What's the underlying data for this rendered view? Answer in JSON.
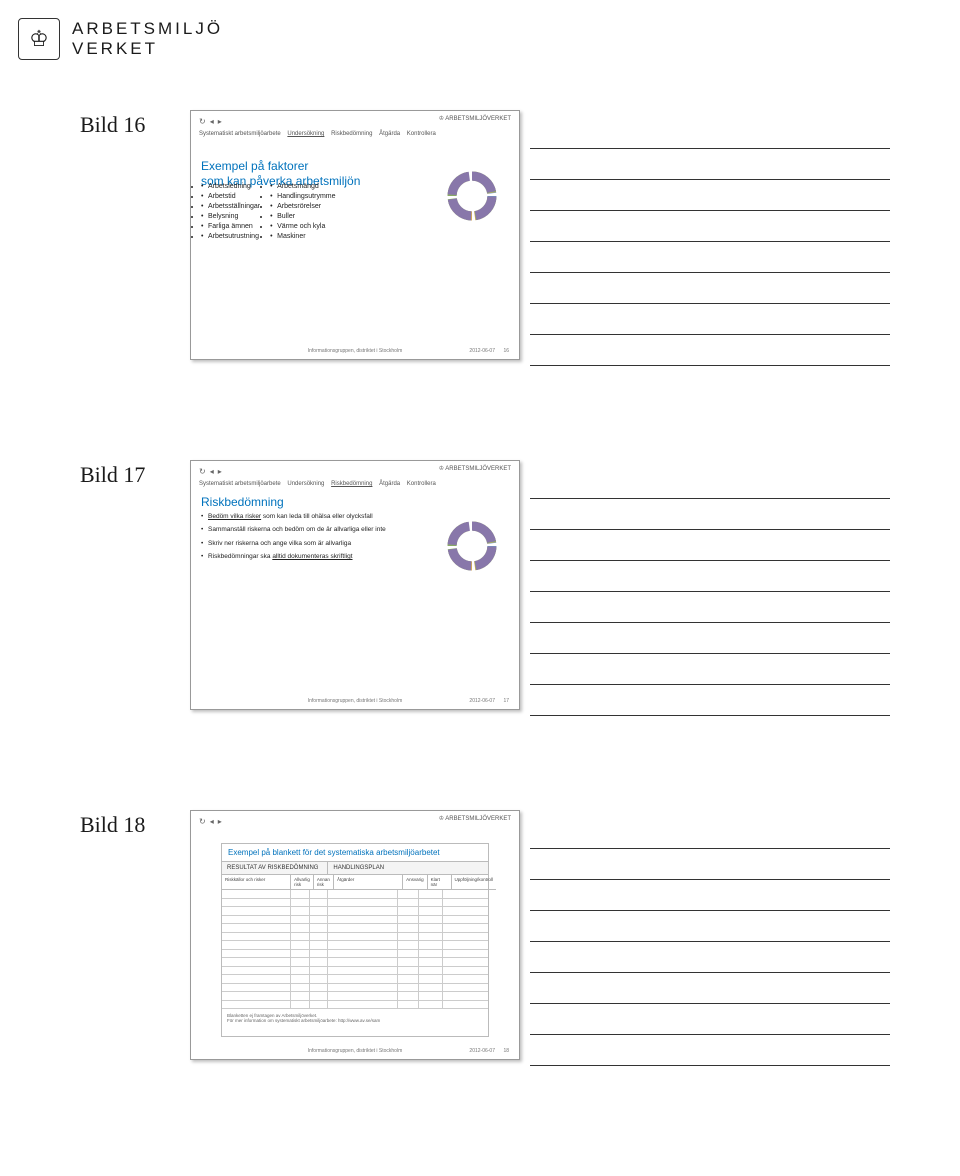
{
  "logo": {
    "line1": "ARBETSMILJÖ",
    "line2": "VERKET",
    "crest_glyph": "♔"
  },
  "slides": [
    {
      "label": "Bild 16",
      "crumbs": [
        "Systematiskt arbetsmiljöarbete",
        "Undersökning",
        "Riskbedömning",
        "Åtgärda",
        "Kontrollera"
      ],
      "crumb_underline_index": 1,
      "title": "Exempel på faktorer\nsom kan påverka arbetsmiljön",
      "left_col": [
        "Arbetsledning",
        "Arbetstid",
        "Arbetsställningar",
        "Belysning",
        "Farliga ämnen",
        "Arbetsutrustning"
      ],
      "right_col": [
        "Arbetsmängd",
        "Handlingsutrymme",
        "Arbetsrörelser",
        "Buller",
        "Värme och kyla",
        "Maskiner"
      ],
      "footer_center": "Informationsgruppen, distriktet i Stockholm",
      "footer_date": "2012-06-07",
      "footer_page": "16"
    },
    {
      "label": "Bild 17",
      "crumbs": [
        "Systematiskt arbetsmiljöarbete",
        "Undersökning",
        "Riskbedömning",
        "Åtgärda",
        "Kontrollera"
      ],
      "crumb_underline_index": 2,
      "title": "Riskbedömning",
      "bullets": [
        {
          "lead_underline": "Bedöm vilka risker",
          "rest": " som kan leda till ohälsa eller olycksfall"
        },
        {
          "lead_underline": "",
          "rest": "Sammanställ riskerna och bedöm om de är allvarliga eller inte"
        },
        {
          "lead_underline": "",
          "rest": "Skriv ner riskerna och ange vilka som är allvarliga"
        },
        {
          "lead_underline": "",
          "rest_before": "Riskbedömningar ska ",
          "mid_underline": "alltid dokumenteras skriftligt",
          "rest": ""
        }
      ],
      "footer_center": "Informationsgruppen, distriktet i Stockholm",
      "footer_date": "2012-06-07",
      "footer_page": "17"
    },
    {
      "label": "Bild 18",
      "blankett_title": "Exempel på blankett för det systematiska arbetsmiljöarbetet",
      "section1": "RESULTAT AV RISKBEDÖMNING",
      "section2": "HANDLINGSPLAN",
      "cols": [
        "Riskkällor och risker",
        "Allvarlig risk",
        "Annan risk",
        "Åtgärder",
        "Ansvarig",
        "Klart när",
        "Uppföljning/kontroll"
      ],
      "note1": "Blanketten ej framtagen av Arbetsmiljöverket.",
      "note2": "För mer information om systematiskt arbetsmiljöarbete: http://www.av.se/sam",
      "footer_center": "Informationsgruppen, distriktet i Stockholm",
      "footer_date": "2012-06-07",
      "footer_page": "18"
    }
  ]
}
